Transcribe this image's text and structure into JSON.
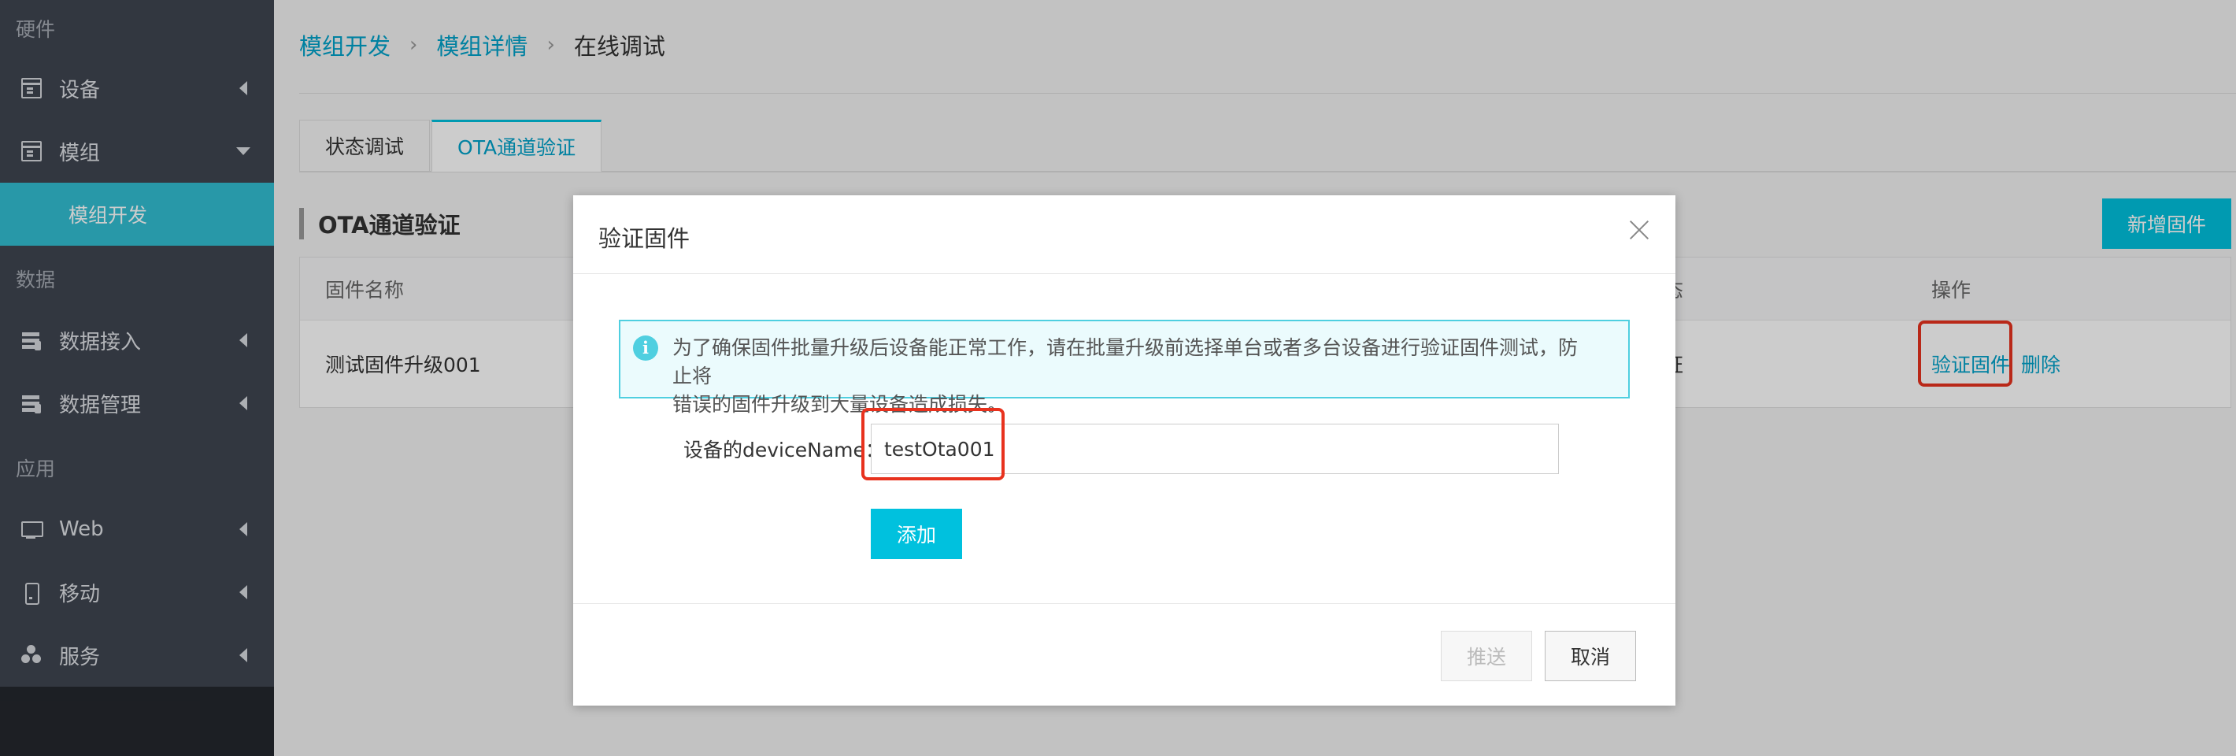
{
  "sidebar": {
    "sections": {
      "hardware": "硬件",
      "data": "数据",
      "apps": "应用"
    },
    "items": [
      {
        "label": "设备",
        "icon": "window-icon"
      },
      {
        "label": "模组",
        "icon": "window-icon"
      },
      {
        "label": "数据接入",
        "icon": "database-icon"
      },
      {
        "label": "数据管理",
        "icon": "database-icon"
      },
      {
        "label": "Web",
        "icon": "monitor-icon"
      },
      {
        "label": "移动",
        "icon": "mobile-icon"
      },
      {
        "label": "服务",
        "icon": "users-icon"
      }
    ],
    "active_sub_item": "模组开发",
    "colors": {
      "bg": "#3f4550",
      "active": "#32bfd2"
    }
  },
  "breadcrumb": [
    "模组开发",
    "模组详情",
    "在线调试"
  ],
  "tabs": [
    {
      "label": "状态调试",
      "active": false
    },
    {
      "label": "OTA通道验证",
      "active": true
    }
  ],
  "section_title": "OTA通道验证",
  "add_firmware_button": "新增固件",
  "table": {
    "columns": [
      "固件名称",
      "态",
      "操作"
    ],
    "rows": [
      {
        "name": "测试固件升级001",
        "status": "证",
        "actions": [
          "验证固件",
          "删除"
        ]
      }
    ]
  },
  "modal": {
    "title": "验证固件",
    "notice_line1": "为了确保固件批量升级后设备能正常工作，请在批量升级前选择单台或者多台设备进行验证固件测试，防止将",
    "notice_line2": "错误的固件升级到大量设备造成损失。",
    "field_label": "设备的deviceName：",
    "field_value": "testOta001",
    "add_button": "添加",
    "push_button": "推送",
    "cancel_button": "取消"
  },
  "accent_color": "#00c1de",
  "highlight_color": "#e8321e"
}
